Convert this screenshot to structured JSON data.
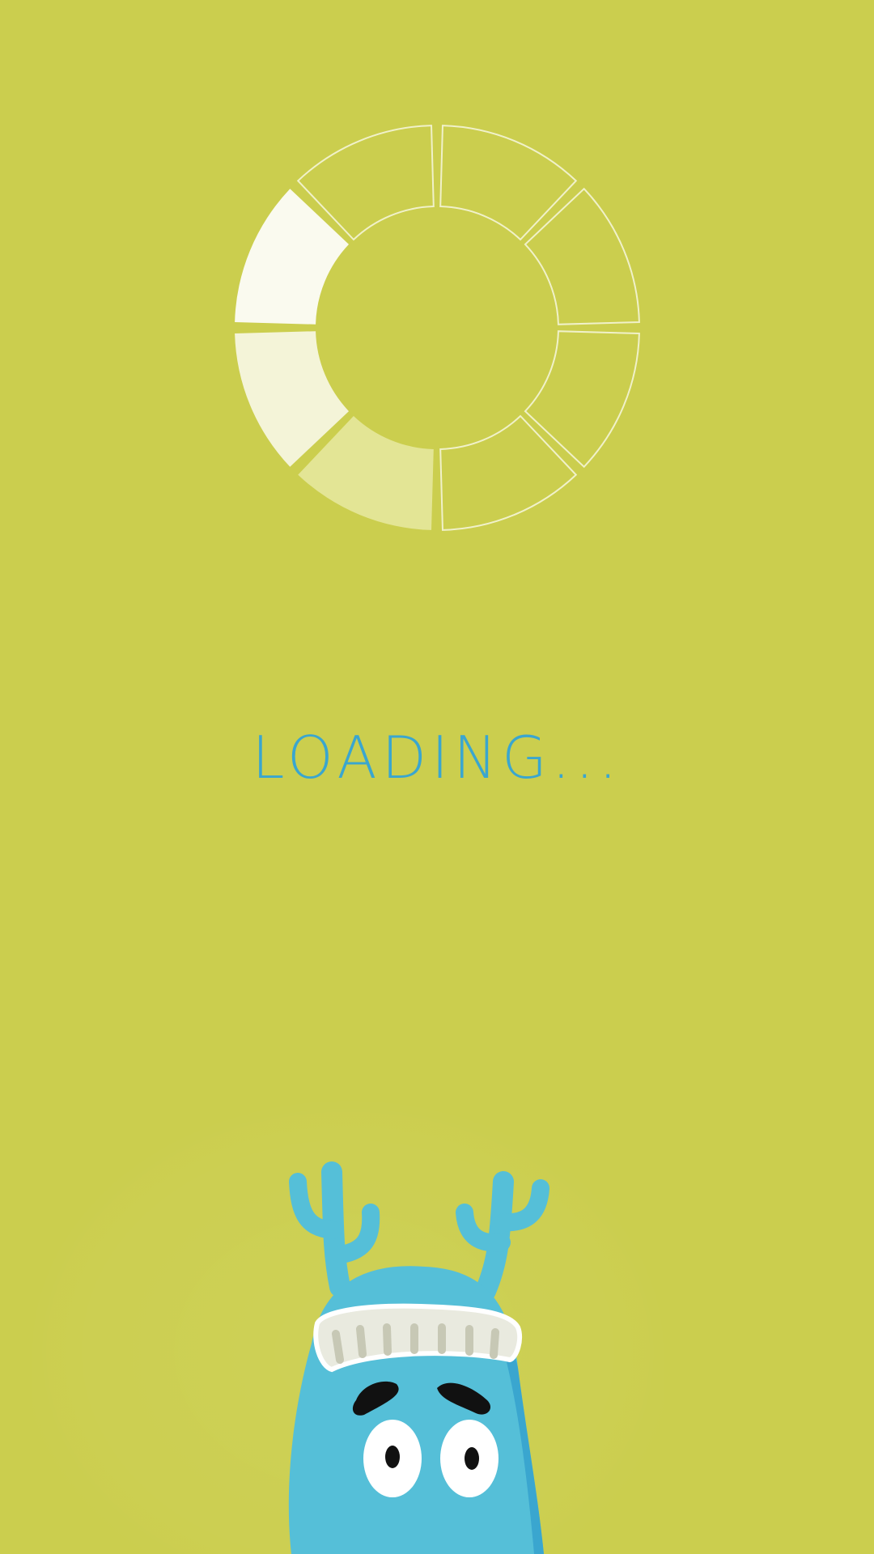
{
  "loading": {
    "text": "LOADING...",
    "color": "#3aa6cf"
  },
  "colors": {
    "background": "#cbce4e",
    "spinner_segment_outline": "#f7f7df",
    "spinner_active": "#fafaef",
    "spinner_mid": "#f4f4d8",
    "spinner_faint": "#e3e595",
    "mascot_body": "#55bfd8",
    "mascot_hat": "#e9eadf"
  },
  "spinner": {
    "segments": 8,
    "highlighted_segments": 3
  },
  "icons": {
    "spinner": "loading-spinner-icon",
    "mascot": "monster-mascot-illustration"
  }
}
